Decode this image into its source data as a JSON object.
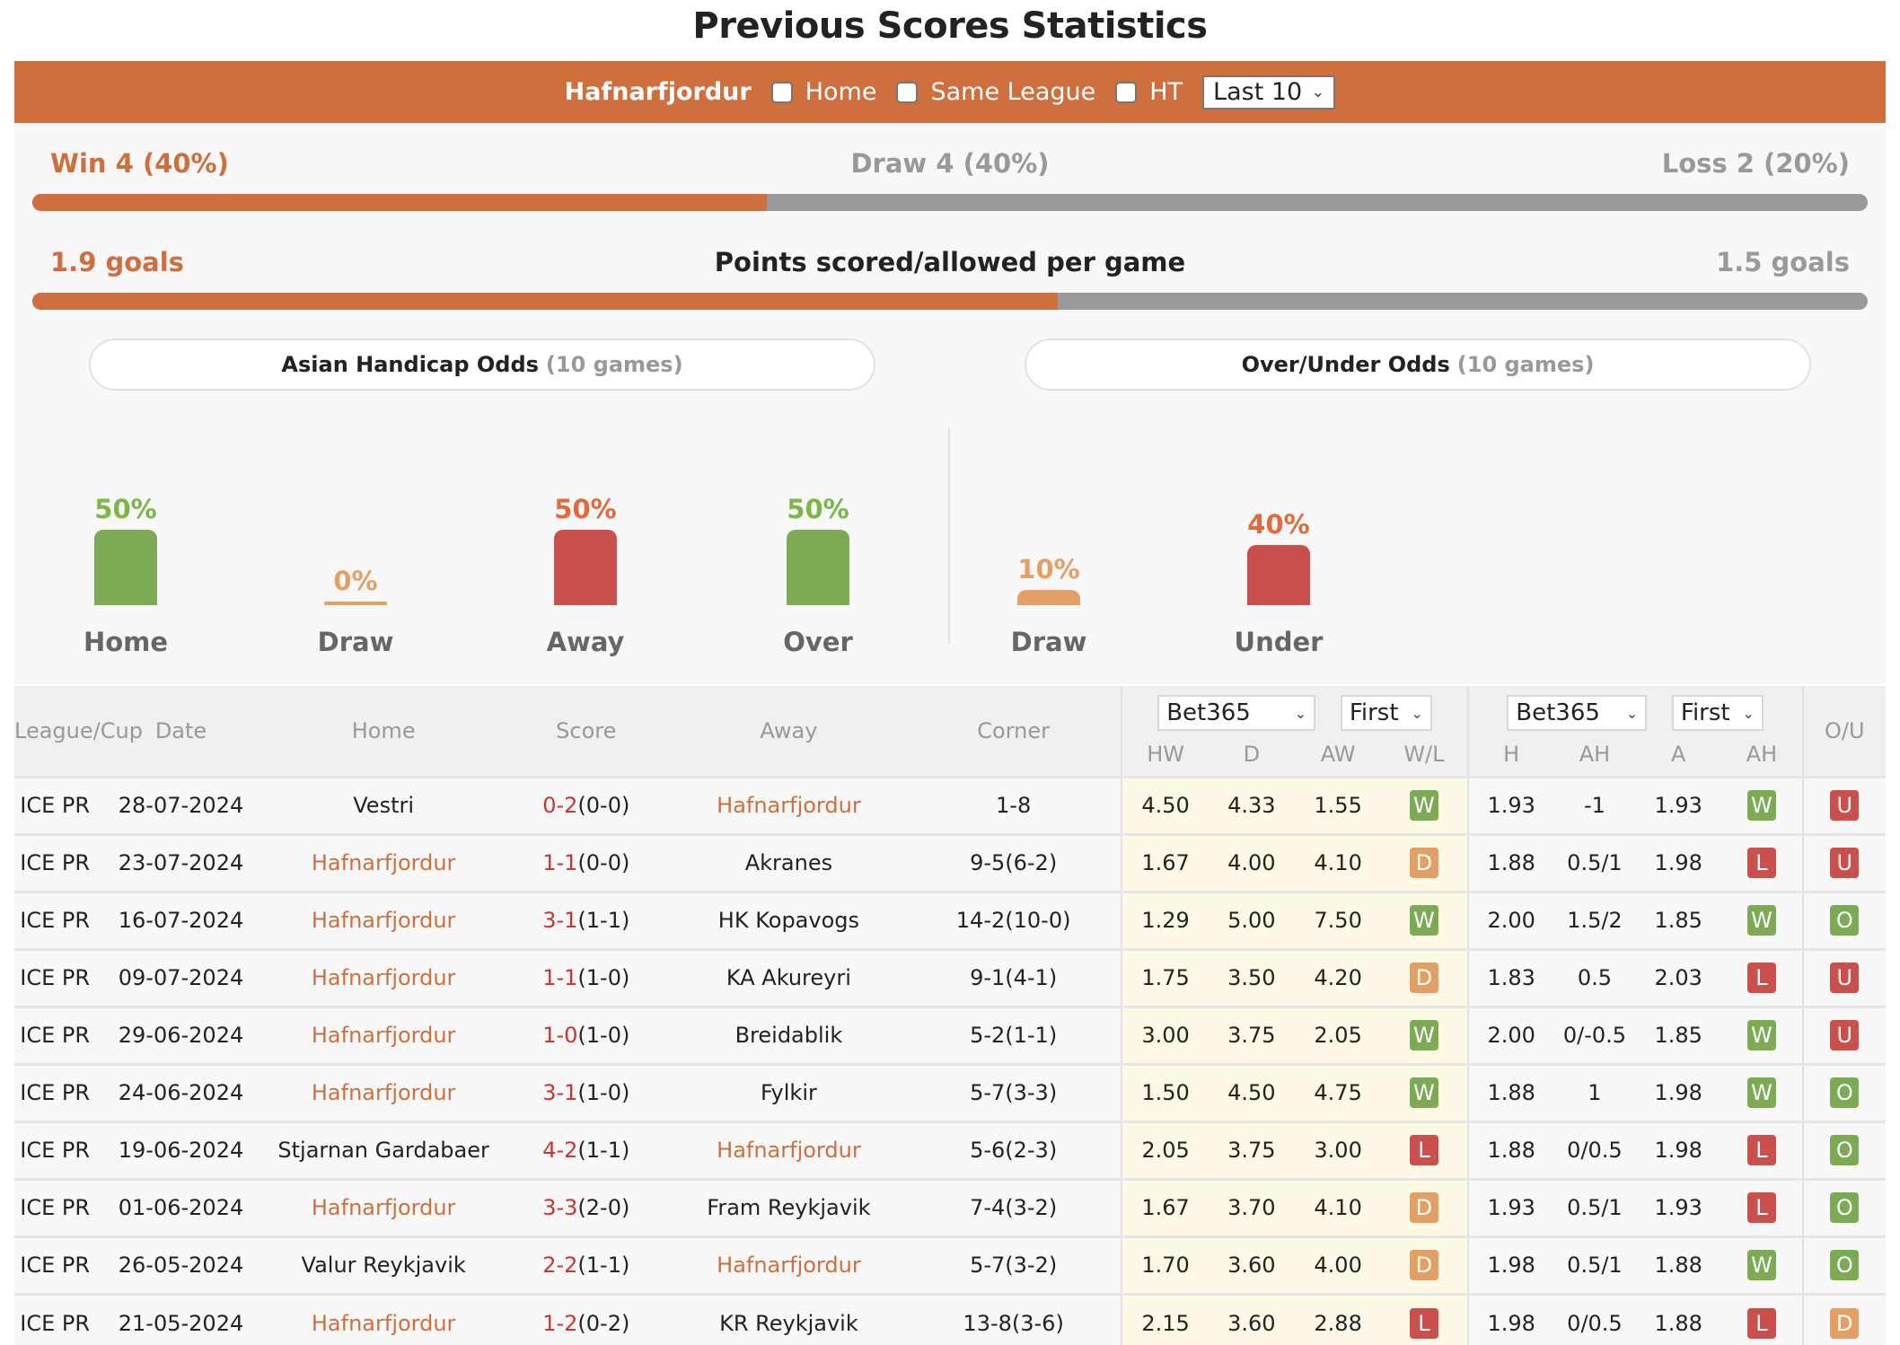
{
  "title": "Previous Scores Statistics",
  "filter_bar": {
    "team": "Hafnarfjordur",
    "checkboxes": [
      {
        "label": "Home",
        "checked": false
      },
      {
        "label": "Same League",
        "checked": false
      },
      {
        "label": "HT",
        "checked": false
      }
    ],
    "range_select": "Last 10"
  },
  "summary": {
    "win_label": "Win 4 (40%)",
    "draw_label": "Draw 4 (40%)",
    "loss_label": "Loss 2 (20%)",
    "win_draw_fill_pct": 40,
    "goals_scored": "1.9 goals",
    "goals_title": "Points scored/allowed per game",
    "goals_allowed": "1.5 goals",
    "goals_scored_value": 1.9,
    "goals_allowed_value": 1.5
  },
  "colors": {
    "accent": "#cf6f3e",
    "green": "#7daa55",
    "red": "#c9504c",
    "orange": "#e4a064",
    "grey": "#999999"
  },
  "chart_data": [
    {
      "type": "bar",
      "title": "Asian Handicap Odds",
      "subtitle": "(10 games)",
      "categories": [
        "Home",
        "Draw",
        "Away"
      ],
      "values": [
        50,
        0,
        50
      ],
      "value_labels": [
        "50%",
        "0%",
        "50%"
      ],
      "colors": [
        "#7daa55",
        "#e4a064",
        "#c9504c"
      ],
      "label_colors": [
        "#7ab648",
        "#e4a064",
        "#e06a3d"
      ],
      "ylim": [
        0,
        100
      ]
    },
    {
      "type": "bar",
      "title": "Over/Under Odds",
      "subtitle": "(10 games)",
      "categories": [
        "Over",
        "Draw",
        "Under"
      ],
      "values": [
        50,
        10,
        40
      ],
      "value_labels": [
        "50%",
        "10%",
        "40%"
      ],
      "colors": [
        "#7daa55",
        "#e4a064",
        "#c9504c"
      ],
      "label_colors": [
        "#7ab648",
        "#e4a064",
        "#e06a3d"
      ],
      "ylim": [
        0,
        100
      ]
    }
  ],
  "table": {
    "headers": {
      "league": "League/Cup",
      "date": "Date",
      "home": "Home",
      "score": "Score",
      "away": "Away",
      "corner": "Corner",
      "ou": "O/U",
      "bookmaker1": "Bet365",
      "period1": "First",
      "bookmaker2": "Bet365",
      "period2": "First",
      "hw": "HW",
      "d": "D",
      "aw": "AW",
      "wl": "W/L",
      "h": "H",
      "ah": "AH",
      "a": "A",
      "ah_result": "AH"
    },
    "rows": [
      {
        "league": "ICE PR",
        "date": "28-07-2024",
        "home": "Vestri",
        "home_hl": false,
        "ft": "0-2",
        "ht": "(0-0)",
        "away": "Hafnarfjordur",
        "away_hl": true,
        "corner": "1-8",
        "hw": "4.50",
        "d": "4.33",
        "aw": "1.55",
        "wl": "W",
        "h": "1.93",
        "ah": "-1",
        "a": "1.93",
        "ahr": "W",
        "ou": "U"
      },
      {
        "league": "ICE PR",
        "date": "23-07-2024",
        "home": "Hafnarfjordur",
        "home_hl": true,
        "ft": "1-1",
        "ht": "(0-0)",
        "away": "Akranes",
        "away_hl": false,
        "corner": "9-5(6-2)",
        "hw": "1.67",
        "d": "4.00",
        "aw": "4.10",
        "wl": "D",
        "h": "1.88",
        "ah": "0.5/1",
        "a": "1.98",
        "ahr": "L",
        "ou": "U"
      },
      {
        "league": "ICE PR",
        "date": "16-07-2024",
        "home": "Hafnarfjordur",
        "home_hl": true,
        "ft": "3-1",
        "ht": "(1-1)",
        "away": "HK Kopavogs",
        "away_hl": false,
        "corner": "14-2(10-0)",
        "hw": "1.29",
        "d": "5.00",
        "aw": "7.50",
        "wl": "W",
        "h": "2.00",
        "ah": "1.5/2",
        "a": "1.85",
        "ahr": "W",
        "ou": "O"
      },
      {
        "league": "ICE PR",
        "date": "09-07-2024",
        "home": "Hafnarfjordur",
        "home_hl": true,
        "ft": "1-1",
        "ht": "(1-0)",
        "away": "KA Akureyri",
        "away_hl": false,
        "corner": "9-1(4-1)",
        "hw": "1.75",
        "d": "3.50",
        "aw": "4.20",
        "wl": "D",
        "h": "1.83",
        "ah": "0.5",
        "a": "2.03",
        "ahr": "L",
        "ou": "U"
      },
      {
        "league": "ICE PR",
        "date": "29-06-2024",
        "home": "Hafnarfjordur",
        "home_hl": true,
        "ft": "1-0",
        "ht": "(1-0)",
        "away": "Breidablik",
        "away_hl": false,
        "corner": "5-2(1-1)",
        "hw": "3.00",
        "d": "3.75",
        "aw": "2.05",
        "wl": "W",
        "h": "2.00",
        "ah": "0/-0.5",
        "a": "1.85",
        "ahr": "W",
        "ou": "U"
      },
      {
        "league": "ICE PR",
        "date": "24-06-2024",
        "home": "Hafnarfjordur",
        "home_hl": true,
        "ft": "3-1",
        "ht": "(1-0)",
        "away": "Fylkir",
        "away_hl": false,
        "corner": "5-7(3-3)",
        "hw": "1.50",
        "d": "4.50",
        "aw": "4.75",
        "wl": "W",
        "h": "1.88",
        "ah": "1",
        "a": "1.98",
        "ahr": "W",
        "ou": "O"
      },
      {
        "league": "ICE PR",
        "date": "19-06-2024",
        "home": "Stjarnan Gardabaer",
        "home_hl": false,
        "ft": "4-2",
        "ht": "(1-1)",
        "away": "Hafnarfjordur",
        "away_hl": true,
        "corner": "5-6(2-3)",
        "hw": "2.05",
        "d": "3.75",
        "aw": "3.00",
        "wl": "L",
        "h": "1.88",
        "ah": "0/0.5",
        "a": "1.98",
        "ahr": "L",
        "ou": "O"
      },
      {
        "league": "ICE PR",
        "date": "01-06-2024",
        "home": "Hafnarfjordur",
        "home_hl": true,
        "ft": "3-3",
        "ht": "(2-0)",
        "away": "Fram Reykjavik",
        "away_hl": false,
        "corner": "7-4(3-2)",
        "hw": "1.67",
        "d": "3.70",
        "aw": "4.10",
        "wl": "D",
        "h": "1.93",
        "ah": "0.5/1",
        "a": "1.93",
        "ahr": "L",
        "ou": "O"
      },
      {
        "league": "ICE PR",
        "date": "26-05-2024",
        "home": "Valur Reykjavik",
        "home_hl": false,
        "ft": "2-2",
        "ht": "(1-1)",
        "away": "Hafnarfjordur",
        "away_hl": true,
        "corner": "5-7(3-2)",
        "hw": "1.70",
        "d": "3.60",
        "aw": "4.00",
        "wl": "D",
        "h": "1.98",
        "ah": "0.5/1",
        "a": "1.88",
        "ahr": "W",
        "ou": "O"
      },
      {
        "league": "ICE PR",
        "date": "21-05-2024",
        "home": "Hafnarfjordur",
        "home_hl": true,
        "ft": "1-2",
        "ht": "(0-2)",
        "away": "KR Reykjavik",
        "away_hl": false,
        "corner": "13-8(3-6)",
        "hw": "2.15",
        "d": "3.60",
        "aw": "2.88",
        "wl": "L",
        "h": "1.98",
        "ah": "0/0.5",
        "a": "1.88",
        "ahr": "L",
        "ou": "D"
      }
    ]
  }
}
